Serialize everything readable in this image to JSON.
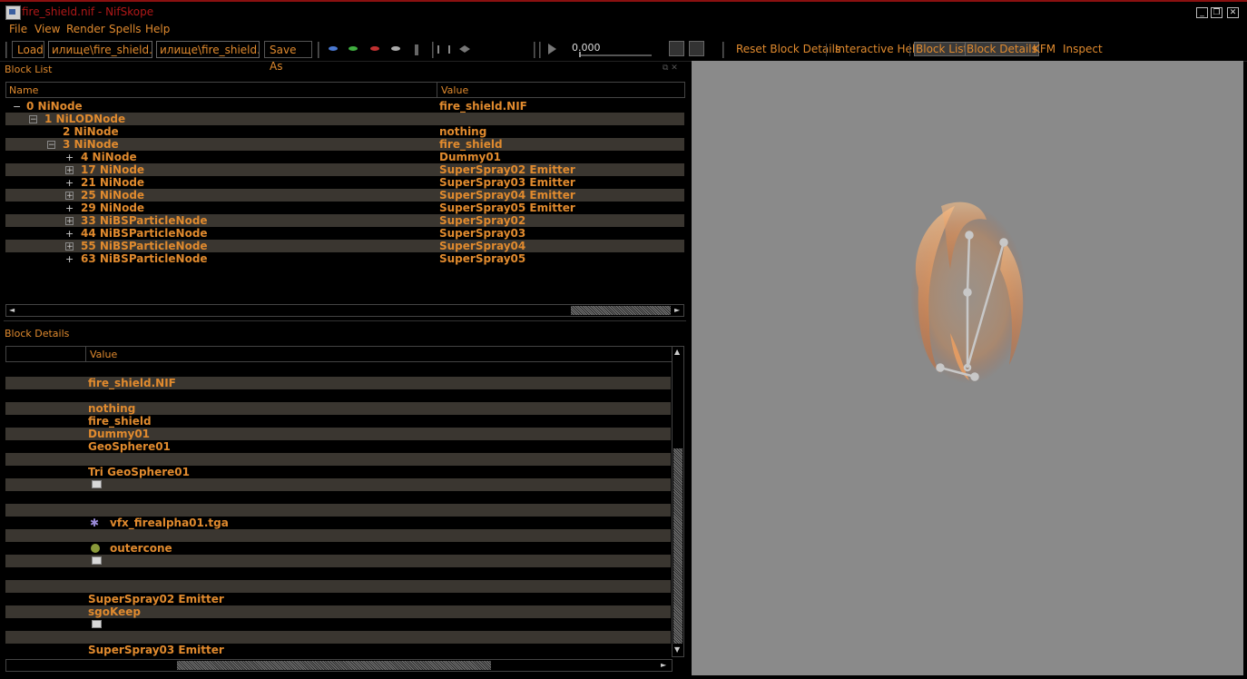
{
  "window": {
    "title": "fire_shield.nif - NifSkope",
    "minimize_label": "_",
    "restore_label": "❐",
    "close_label": "✕"
  },
  "menubar": {
    "items": [
      "File",
      "View",
      "Render",
      "Spells",
      "Help"
    ]
  },
  "toolbar": {
    "load_label": "Load",
    "load_path": "илище\\fire_shield.nif",
    "save_path": "илище\\fire_shield.nif",
    "save_as_label": "Save As",
    "time_value": "0.000",
    "links": [
      "Reset Block Details",
      "Interactive Help",
      "Block List",
      "Block Details",
      "KFM",
      "Inspect"
    ]
  },
  "block_list": {
    "title": "Block List",
    "columns": [
      "Name",
      "Value"
    ],
    "rows": [
      {
        "name": "0 NiNode",
        "value": "fire_shield.NIF"
      },
      {
        "name": "1 NiLODNode",
        "value": ""
      },
      {
        "name": "2 NiNode",
        "value": "nothing"
      },
      {
        "name": "3 NiNode",
        "value": "fire_shield"
      },
      {
        "name": "4 NiNode",
        "value": "Dummy01"
      },
      {
        "name": "17 NiNode",
        "value": "SuperSpray02 Emitter"
      },
      {
        "name": "21 NiNode",
        "value": "SuperSpray03 Emitter"
      },
      {
        "name": "25 NiNode",
        "value": "SuperSpray04 Emitter"
      },
      {
        "name": "29 NiNode",
        "value": "SuperSpray05 Emitter"
      },
      {
        "name": "33 NiBSParticleNode",
        "value": "SuperSpray02"
      },
      {
        "name": "44 NiBSParticleNode",
        "value": "SuperSpray03"
      },
      {
        "name": "55 NiBSParticleNode",
        "value": "SuperSpray04"
      },
      {
        "name": "63 NiBSParticleNode",
        "value": "SuperSpray05"
      }
    ]
  },
  "block_details": {
    "title": "Block Details",
    "column": "Value",
    "rows": [
      {
        "value": ""
      },
      {
        "value": "fire_shield.NIF"
      },
      {
        "value": ""
      },
      {
        "value": "nothing"
      },
      {
        "value": "fire_shield"
      },
      {
        "value": "Dummy01"
      },
      {
        "value": "GeoSphere01"
      },
      {
        "value": ""
      },
      {
        "value": "Tri GeoSphere01"
      },
      {
        "value": "",
        "icon": "block-icon"
      },
      {
        "value": ""
      },
      {
        "value": ""
      },
      {
        "value": "vfx_firealpha01.tga",
        "icon": "texture-icon"
      },
      {
        "value": ""
      },
      {
        "value": "outercone",
        "icon": "material-icon"
      },
      {
        "value": "",
        "icon": "block-icon"
      },
      {
        "value": ""
      },
      {
        "value": ""
      },
      {
        "value": "SuperSpray02 Emitter"
      },
      {
        "value": "sgoKeep"
      },
      {
        "value": "",
        "icon": "block-icon"
      },
      {
        "value": ""
      },
      {
        "value": "SuperSpray03 Emitter"
      }
    ]
  },
  "colors": {
    "accent": "#e08a2e",
    "title_red": "#b01818",
    "row_alt": "#3a3630",
    "viewport_bg": "#8a8a8a"
  }
}
